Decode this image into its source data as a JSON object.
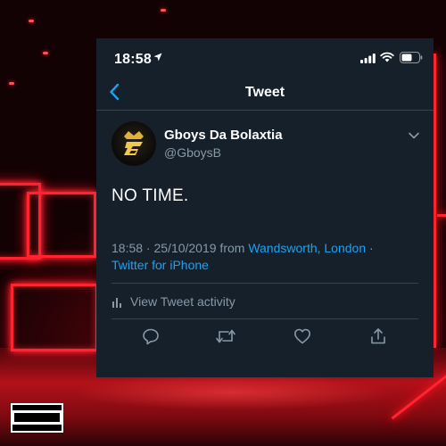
{
  "status_bar": {
    "time": "18:58"
  },
  "nav": {
    "title": "Tweet"
  },
  "tweet": {
    "display_name": "Gboys Da Bolaxtia",
    "handle": "@GboysB",
    "text": "NO TIME.",
    "timestamp": "18:58 · 25/10/2019 from ",
    "location": "Wandsworth, London",
    "separator": " ·",
    "source": "Twitter for iPhone"
  },
  "activity": {
    "label": "View Tweet activity"
  },
  "actions": [
    "reply-icon",
    "retweet-icon",
    "like-icon",
    "share-icon"
  ],
  "colors": {
    "background": "#15202b",
    "accent": "#1da1f2",
    "secondary_text": "#8899a6",
    "divider": "#38444d",
    "neon": "#ff2430"
  }
}
